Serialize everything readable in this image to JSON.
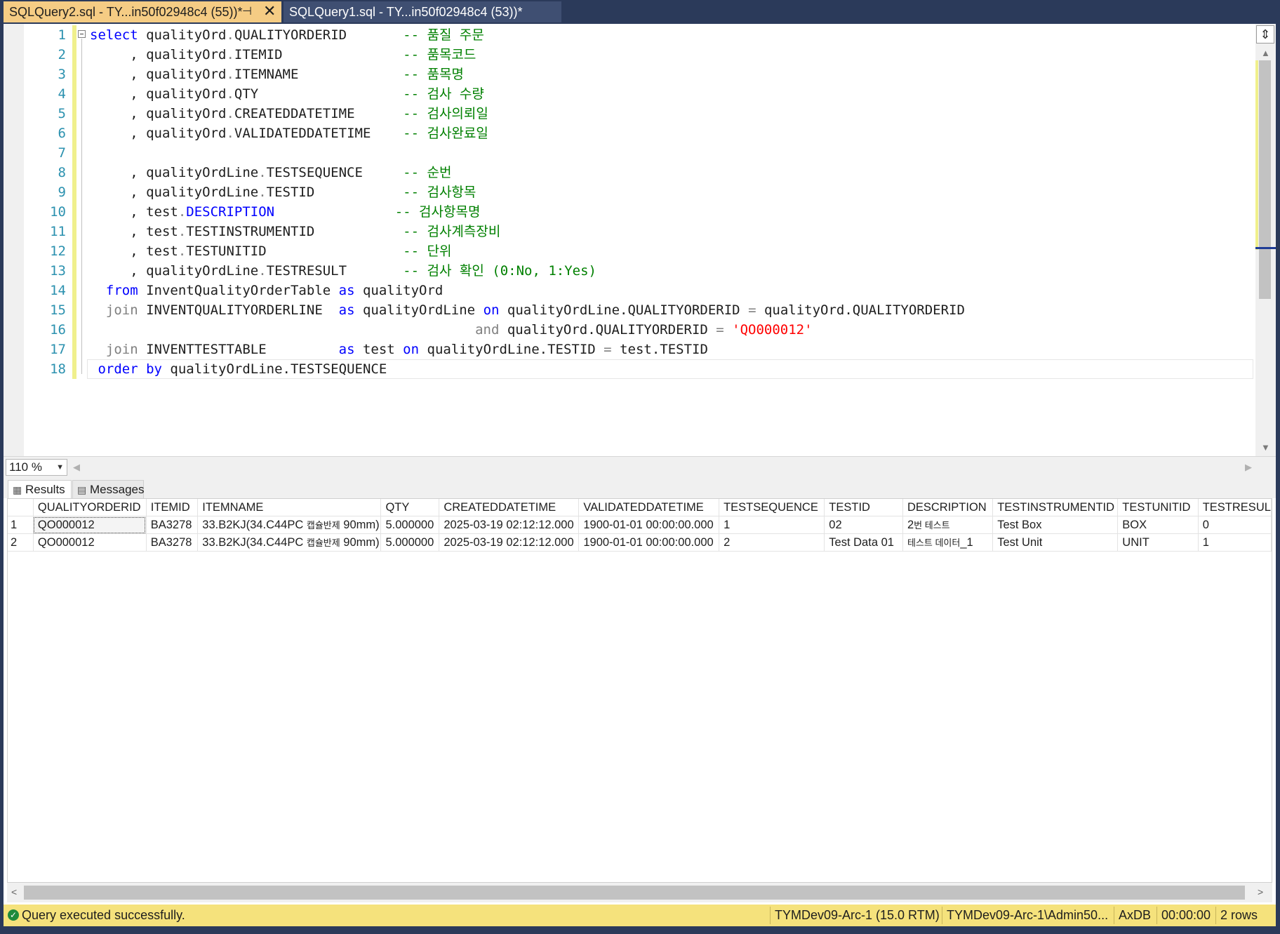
{
  "tabs": [
    {
      "title": "SQLQuery2.sql - TY...in50f02948c4 (55))*",
      "active": true
    },
    {
      "title": "SQLQuery1.sql - TY...in50f02948c4 (53))*",
      "active": false
    }
  ],
  "editor": {
    "line_numbers": [
      "1",
      "2",
      "3",
      "4",
      "5",
      "6",
      "7",
      "8",
      "9",
      "10",
      "11",
      "12",
      "13",
      "14",
      "15",
      "16",
      "17",
      "18"
    ],
    "lines": {
      "l1": {
        "kw": "select",
        "code": " qualityOrd",
        "dot": ".",
        "col": "QUALITYORDERID       ",
        "cm": "-- 품질 주문"
      },
      "l2": {
        "pre": "     , qualityOrd",
        "dot": ".",
        "col": "ITEMID               ",
        "cm": "-- 품목코드"
      },
      "l3": {
        "pre": "     , qualityOrd",
        "dot": ".",
        "col": "ITEMNAME             ",
        "cm": "-- 품목명"
      },
      "l4": {
        "pre": "     , qualityOrd",
        "dot": ".",
        "col": "QTY                  ",
        "cm": "-- 검사 수량"
      },
      "l5": {
        "pre": "     , qualityOrd",
        "dot": ".",
        "col": "CREATEDDATETIME      ",
        "cm": "-- 검사의뢰일"
      },
      "l6": {
        "pre": "     , qualityOrd",
        "dot": ".",
        "col": "VALIDATEDDATETIME    ",
        "cm": "-- 검사완료일"
      },
      "l8": {
        "pre": "     , qualityOrdLine",
        "dot": ".",
        "col": "TESTSEQUENCE     ",
        "cm": "-- 순번"
      },
      "l9": {
        "pre": "     , qualityOrdLine",
        "dot": ".",
        "col": "TESTID           ",
        "cm": "-- 검사항목"
      },
      "l10": {
        "pre": "     , test",
        "dot": ".",
        "fncol": "DESCRIPTION",
        "pad": "               ",
        "cm": "-- 검사항목명"
      },
      "l11": {
        "pre": "     , test",
        "dot": ".",
        "col": "TESTINSTRUMENTID           ",
        "cm": "-- 검사계측장비"
      },
      "l12": {
        "pre": "     , test",
        "dot": ".",
        "col": "TESTUNITID                 ",
        "cm": "-- 단위"
      },
      "l13": {
        "pre": "     , qualityOrdLine",
        "dot": ".",
        "col": "TESTRESULT       ",
        "cm": "-- 검사 확인 (0:No, 1:Yes)"
      },
      "l14": {
        "indent": "  ",
        "kw": "from",
        "code": " InventQualityOrderTable ",
        "kw2": "as",
        "code2": " qualityOrd"
      },
      "l15": {
        "indent": "  ",
        "kwg": "join",
        "code": " INVENTQUALITYORDERLINE  ",
        "kw2": "as",
        "code2": " qualityOrdLine ",
        "kw3": "on",
        "code3": " qualityOrdLine.QUALITYORDERID ",
        "op": "=",
        "code4": " qualityOrd.QUALITYORDERID"
      },
      "l16": {
        "indent": "                                                ",
        "kwg": "and",
        "code": " qualityOrd.QUALITYORDERID ",
        "op": "=",
        "str": " 'QO000012'"
      },
      "l17": {
        "indent": "  ",
        "kwg": "join",
        "code": " INVENTTESTTABLE         ",
        "kw2": "as",
        "code2": " test ",
        "kw3": "on",
        "code3": " qualityOrdLine.TESTID ",
        "op": "=",
        "code4": " test.TESTID"
      },
      "l18": {
        "indent": " ",
        "kw": "order by",
        "code": " qualityOrdLine.TESTSEQUENCE"
      }
    }
  },
  "zoom": {
    "value": "110 %"
  },
  "result_tabs": {
    "results": "Results",
    "messages": "Messages"
  },
  "grid": {
    "columns": [
      "",
      "QUALITYORDERID",
      "ITEMID",
      "ITEMNAME",
      "QTY",
      "CREATEDDATETIME",
      "VALIDATEDDATETIME",
      "TESTSEQUENCE",
      "TESTID",
      "DESCRIPTION",
      "TESTINSTRUMENTID",
      "TESTUNITID",
      "TESTRESUL"
    ],
    "rows": [
      {
        "n": "1",
        "qid": "QO000012",
        "itemid": "BA3278",
        "itemname_a": "33.B2KJ(34.C44PC ",
        "itemname_b": "캡슐반제",
        "itemname_c": " 90mm)",
        "qty": "5.000000",
        "created": "2025-03-19 02:12:12.000",
        "validated": "1900-01-01 00:00:00.000",
        "seq": "1",
        "testid": "02",
        "desc_a": "2",
        "desc_b": "번 테스트",
        "desc_c": "",
        "instrument": "Test Box",
        "unit": "BOX",
        "result": "0"
      },
      {
        "n": "2",
        "qid": "QO000012",
        "itemid": "BA3278",
        "itemname_a": "33.B2KJ(34.C44PC ",
        "itemname_b": "캡슐반제",
        "itemname_c": " 90mm)",
        "qty": "5.000000",
        "created": "2025-03-19 02:12:12.000",
        "validated": "1900-01-01 00:00:00.000",
        "seq": "2",
        "testid": "Test Data 01",
        "desc_a": "",
        "desc_b": "테스트 데이터",
        "desc_c": "_1",
        "instrument": "Test Unit",
        "unit": "UNIT",
        "result": "1"
      }
    ]
  },
  "status": {
    "message": "Query executed successfully.",
    "server": "TYMDev09-Arc-1 (15.0 RTM)",
    "user": "TYMDev09-Arc-1\\Admin50...",
    "database": "AxDB",
    "elapsed": "00:00:00",
    "rows": "2 rows"
  },
  "colors": {
    "active_tab": "#f5cc84",
    "frame": "#2b3a5a",
    "status_bar": "#f5e27c",
    "keyword": "#0000ff",
    "comment": "#008000",
    "string": "#ff0000",
    "line_number": "#2b91af"
  }
}
